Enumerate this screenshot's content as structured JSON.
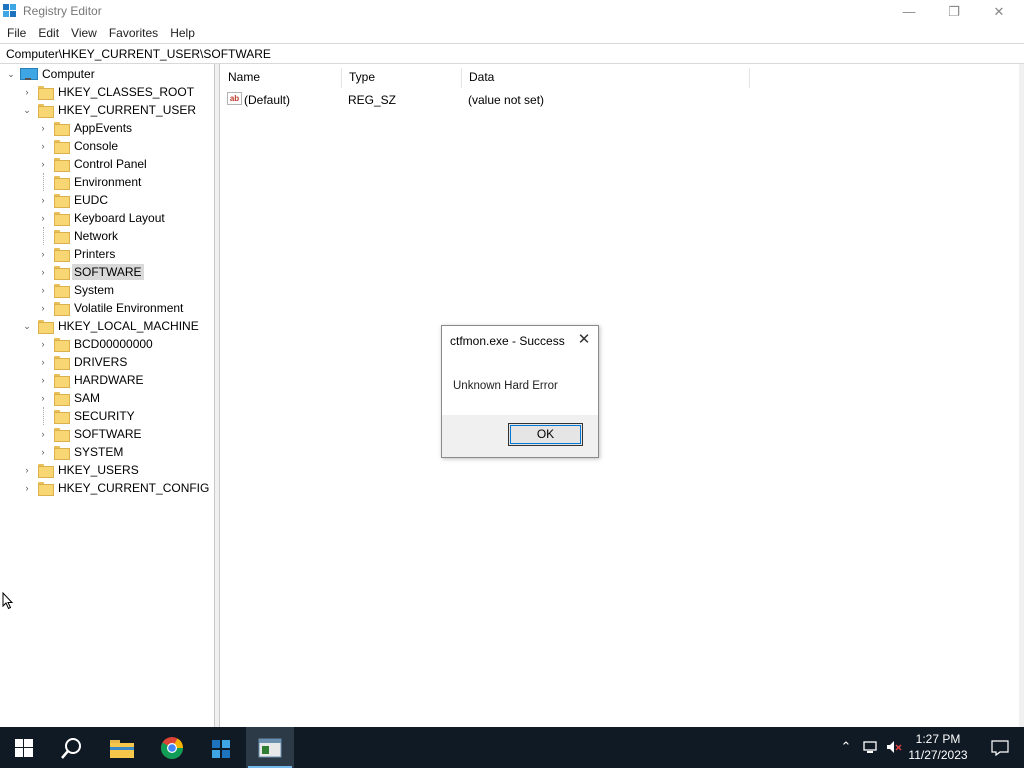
{
  "window": {
    "title": "Registry Editor",
    "min_glyph": "—",
    "max_glyph": "❐",
    "close_glyph": "✕"
  },
  "menu": [
    "File",
    "Edit",
    "View",
    "Favorites",
    "Help"
  ],
  "address": "Computer\\HKEY_CURRENT_USER\\SOFTWARE",
  "tree": {
    "root": "Computer",
    "nodes": [
      {
        "label": "HKEY_CLASSES_ROOT",
        "expander": "›"
      },
      {
        "label": "HKEY_CURRENT_USER",
        "expander": "⌄"
      },
      {
        "label": "AppEvents",
        "expander": "›"
      },
      {
        "label": "Console",
        "expander": "›"
      },
      {
        "label": "Control Panel",
        "expander": "›"
      },
      {
        "label": "Environment",
        "expander": ""
      },
      {
        "label": "EUDC",
        "expander": "›"
      },
      {
        "label": "Keyboard Layout",
        "expander": "›"
      },
      {
        "label": "Network",
        "expander": ""
      },
      {
        "label": "Printers",
        "expander": "›"
      },
      {
        "label": "SOFTWARE",
        "expander": "›"
      },
      {
        "label": "System",
        "expander": "›"
      },
      {
        "label": "Volatile Environment",
        "expander": "›"
      },
      {
        "label": "HKEY_LOCAL_MACHINE",
        "expander": "⌄"
      },
      {
        "label": "BCD00000000",
        "expander": "›"
      },
      {
        "label": "DRIVERS",
        "expander": "›"
      },
      {
        "label": "HARDWARE",
        "expander": "›"
      },
      {
        "label": "SAM",
        "expander": "›"
      },
      {
        "label": "SECURITY",
        "expander": ""
      },
      {
        "label": "SOFTWARE",
        "expander": "›"
      },
      {
        "label": "SYSTEM",
        "expander": "›"
      },
      {
        "label": "HKEY_USERS",
        "expander": "›"
      },
      {
        "label": "HKEY_CURRENT_CONFIG",
        "expander": "›"
      }
    ]
  },
  "values": {
    "columns": [
      "Name",
      "Type",
      "Data"
    ],
    "rows": [
      {
        "icon": "string-value-icon",
        "icon_text": "ab",
        "name": "(Default)",
        "type": "REG_SZ",
        "data": "(value not set)"
      }
    ]
  },
  "dialog": {
    "title": "ctfmon.exe - Success",
    "close_glyph": "✕",
    "message": "Unknown Hard Error",
    "ok_label": "OK"
  },
  "taskbar": {
    "items": [
      "start-button",
      "search-button",
      "file-explorer",
      "chrome",
      "regedit-app",
      "active-window"
    ],
    "tray_up_glyph": "⌃",
    "time": "1:27 PM",
    "date": "11/27/2023"
  },
  "colors": {
    "taskbar_bg": "#101a24",
    "accent": "#0078d7",
    "folder": "#f7d673",
    "selection": "#d9d9d9"
  }
}
